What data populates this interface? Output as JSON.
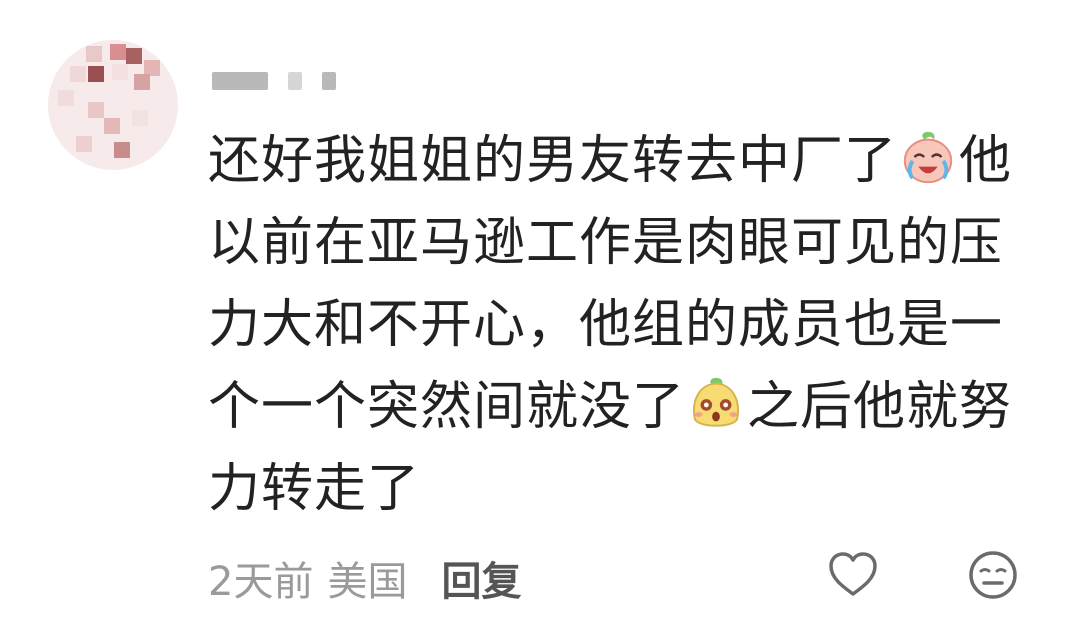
{
  "comment": {
    "lines": [
      {
        "text": "还好我姐姐的男友转去中厂了",
        "emoji": "crying-face-emoji",
        "tail": "他"
      },
      {
        "text": "以前在亚马逊工作是肉眼可见的压"
      },
      {
        "text": "力大和不开心，他组的成员也是一"
      },
      {
        "text": "个一个突然间就没了",
        "emoji": "surprised-face-emoji",
        "tail": "之后他就努"
      },
      {
        "text": "力转走了"
      }
    ],
    "time": "2天前",
    "location": "美国",
    "reply_label": "回复"
  },
  "icons": {
    "like": "heart-outline-icon",
    "dislike": "meh-face-icon"
  },
  "colors": {
    "text": "#222222",
    "meta": "#9a9a9a",
    "reply": "#555555",
    "icon": "#6b6b6b"
  }
}
